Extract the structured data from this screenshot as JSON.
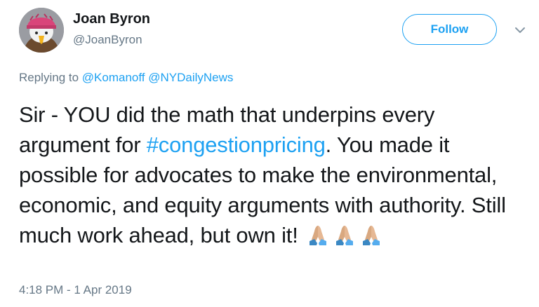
{
  "user": {
    "name": "Joan Byron",
    "handle": "@JoanByron"
  },
  "follow_button": {
    "label": "Follow"
  },
  "menu": {
    "icon": "chevron-down-icon"
  },
  "reply_context": {
    "prefix": "Replying to",
    "mentions": [
      "@Komanoff",
      "@NYDailyNews"
    ]
  },
  "tweet": {
    "text_before": "Sir - YOU did the math that underpins every argument for ",
    "hashtag": "#congestionpricing",
    "text_after": ". You made it possible for advocates to make the environmental, economic, and equity arguments with authority. Still much work ahead, but own it!",
    "emojis": [
      "folded-hands-icon",
      "folded-hands-icon",
      "folded-hands-icon"
    ]
  },
  "timestamp": "4:18 PM - 1 Apr 2019",
  "colors": {
    "accent": "#1da1f2",
    "text": "#14171a",
    "secondary": "#657786"
  }
}
